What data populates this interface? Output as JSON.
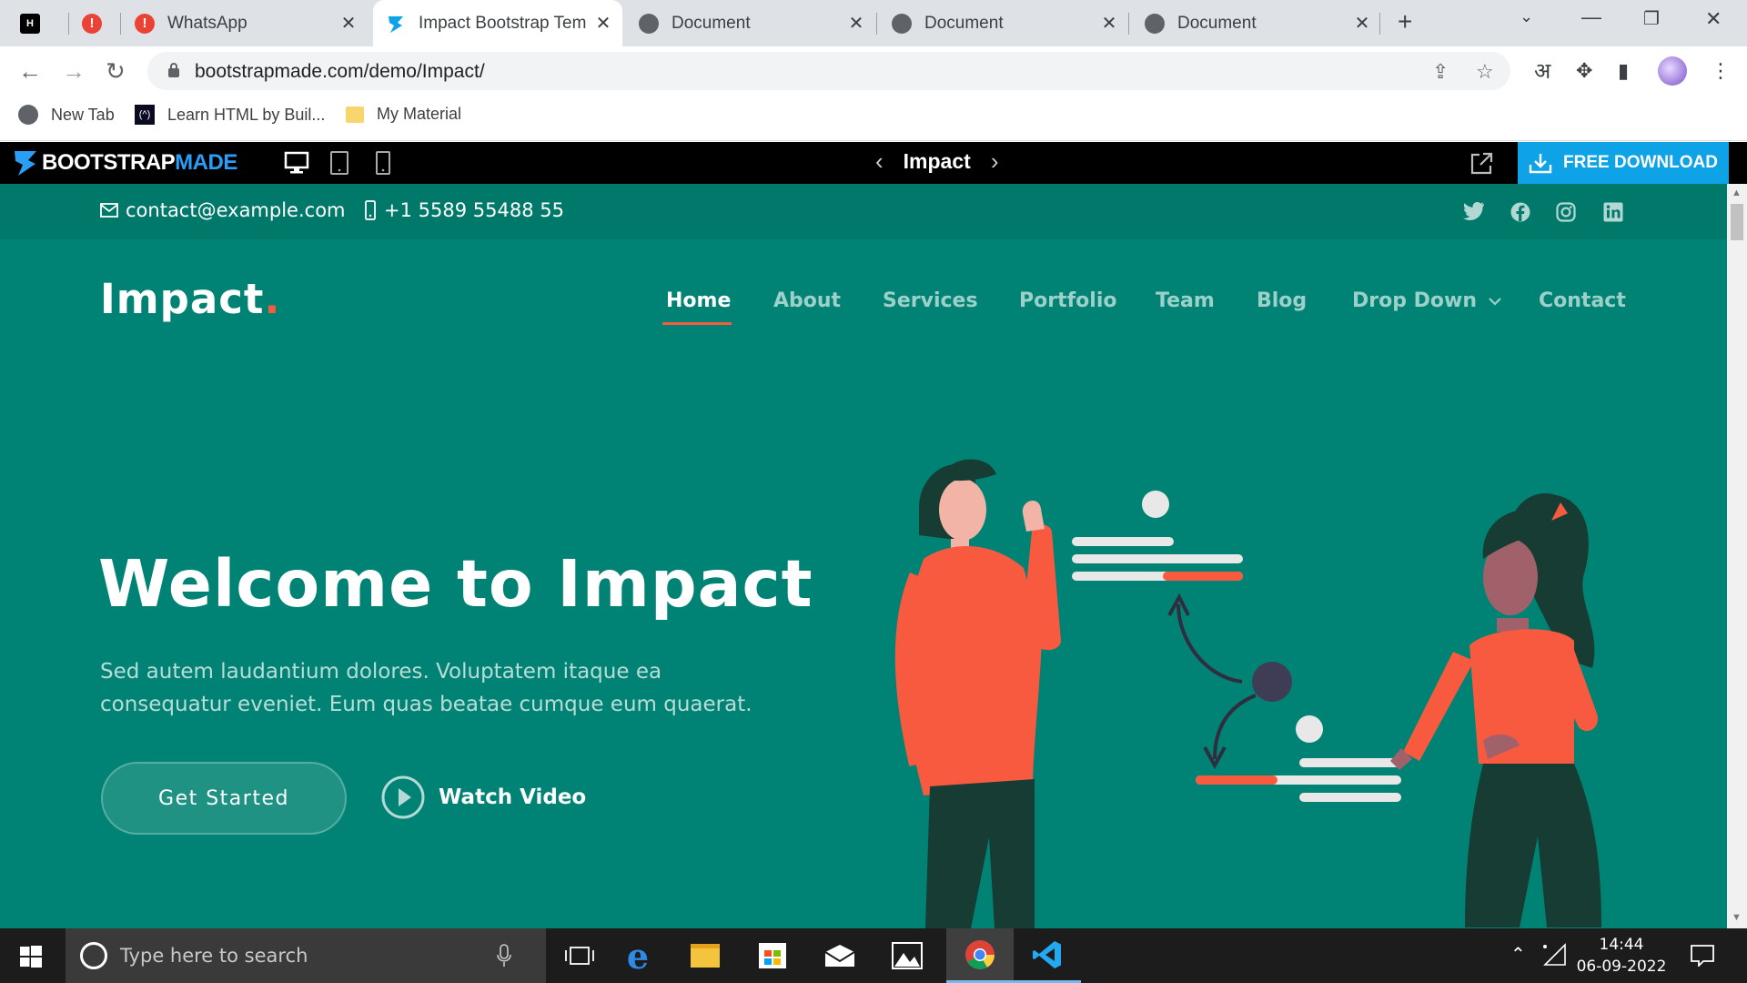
{
  "browser": {
    "tabs": [
      {
        "title": "",
        "favicon": "hackerrank-icon"
      },
      {
        "title": "",
        "favicon": "alert-icon"
      },
      {
        "title": "WhatsApp",
        "favicon": "alert-icon"
      },
      {
        "title": "Impact Bootstrap Temp",
        "favicon": "bootstrapmade-icon",
        "active": true
      },
      {
        "title": "Document",
        "favicon": "globe-icon"
      },
      {
        "title": "Document",
        "favicon": "globe-icon"
      },
      {
        "title": "Document",
        "favicon": "globe-icon"
      }
    ],
    "url": "bootstrapmade.com/demo/Impact/",
    "hindi_icon": "अ",
    "bookmarks": [
      {
        "label": "New Tab",
        "icon": "globe-icon"
      },
      {
        "label": "Learn HTML by Buil...",
        "icon": "freecodecamp-icon"
      },
      {
        "label": "My Material",
        "icon": "folder-icon"
      }
    ]
  },
  "bmbar": {
    "logo_part1": "BOOTSTRAP",
    "logo_part2": "MADE",
    "template_name": "Impact",
    "download_label": "FREE DOWNLOAD"
  },
  "site": {
    "email": "contact@example.com",
    "phone": "+1 5589 55488 55",
    "social": [
      "twitter-icon",
      "facebook-icon",
      "instagram-icon",
      "linkedin-icon"
    ],
    "brand": "Impact",
    "brand_dot": ".",
    "nav": [
      "Home",
      "About",
      "Services",
      "Portfolio",
      "Team",
      "Blog",
      "Drop Down",
      "Contact"
    ],
    "hero_title": "Welcome to Impact",
    "hero_text": "Sed autem laudantium dolores. Voluptatem itaque ea consequatur eveniet. Eum quas beatae cumque eum quaerat.",
    "cta_primary": "Get Started",
    "cta_secondary": "Watch Video",
    "colors": {
      "primary": "#008374",
      "accent": "#f85a40",
      "topbar": "#00796b"
    }
  },
  "taskbar": {
    "search_placeholder": "Type here to search",
    "time": "14:44",
    "date": "06-09-2022"
  }
}
